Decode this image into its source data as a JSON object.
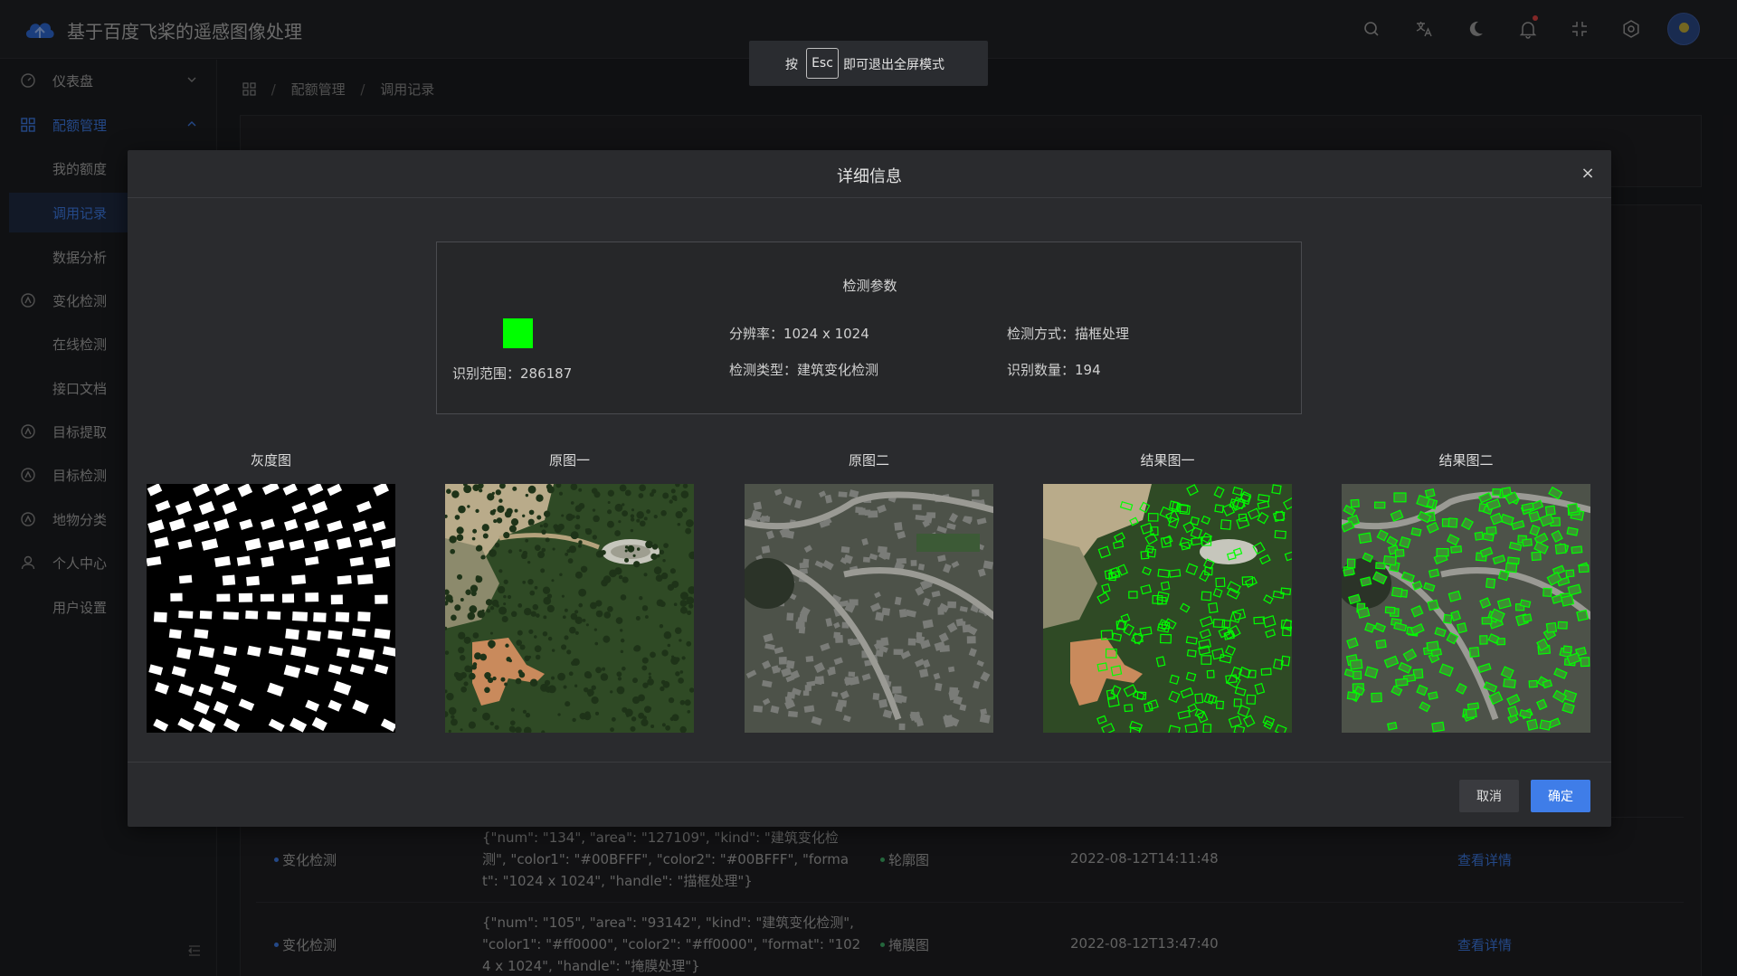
{
  "app": {
    "title": "基于百度飞桨的遥感图像处理"
  },
  "header": {
    "icons": [
      "search-icon",
      "translate-icon",
      "moon-icon",
      "bell-icon",
      "fullscreen-exit-icon",
      "settings-icon"
    ]
  },
  "sidebar": {
    "items": [
      {
        "label": "仪表盘"
      },
      {
        "label": "配额管理"
      },
      {
        "label": "我的额度"
      },
      {
        "label": "调用记录"
      },
      {
        "label": "数据分析"
      },
      {
        "label": "变化检测"
      },
      {
        "label": "在线检测"
      },
      {
        "label": "接口文档"
      },
      {
        "label": "目标提取"
      },
      {
        "label": "目标检测"
      },
      {
        "label": "地物分类"
      },
      {
        "label": "个人中心"
      },
      {
        "label": "用户设置"
      }
    ]
  },
  "breadcrumb": {
    "level1": "配额管理",
    "level2": "调用记录"
  },
  "esc_toast": {
    "prefix": "按",
    "key": "Esc",
    "suffix": "即可退出全屏模式"
  },
  "modal": {
    "title": "详细信息",
    "close": "×",
    "params": {
      "title": "检测参数",
      "swatch_color": "#00FF00",
      "area": "识别范围：286187",
      "resolution": "分辨率：1024 x 1024",
      "method": "检测方式：描框处理",
      "type": "检测类型：建筑变化检测",
      "count": "识别数量：194"
    },
    "images": [
      {
        "label": "灰度图"
      },
      {
        "label": "原图一"
      },
      {
        "label": "原图二"
      },
      {
        "label": "结果图一"
      },
      {
        "label": "结果图二"
      }
    ],
    "cancel_label": "取消",
    "ok_label": "确定"
  },
  "records": [
    {
      "type": "变化检测",
      "params": "{\"num\": \"134\", \"area\": \"127109\", \"kind\": \"建筑变化检测\", \"color1\": \"#00BFFF\", \"color2\": \"#00BFFF\", \"format\": \"1024 x 1024\", \"handle\": \"描框处理\"}",
      "kind": "轮廓图",
      "time": "2022-08-12T14:11:48",
      "action": "查看详情"
    },
    {
      "type": "变化检测",
      "params": "{\"num\": \"105\", \"area\": \"93142\", \"kind\": \"建筑变化检测\", \"color1\": \"#ff0000\", \"color2\": \"#ff0000\", \"format\": \"1024 x 1024\", \"handle\": \"掩膜处理\"}",
      "kind": "掩膜图",
      "time": "2022-08-12T13:47:40",
      "action": "查看详情"
    }
  ]
}
